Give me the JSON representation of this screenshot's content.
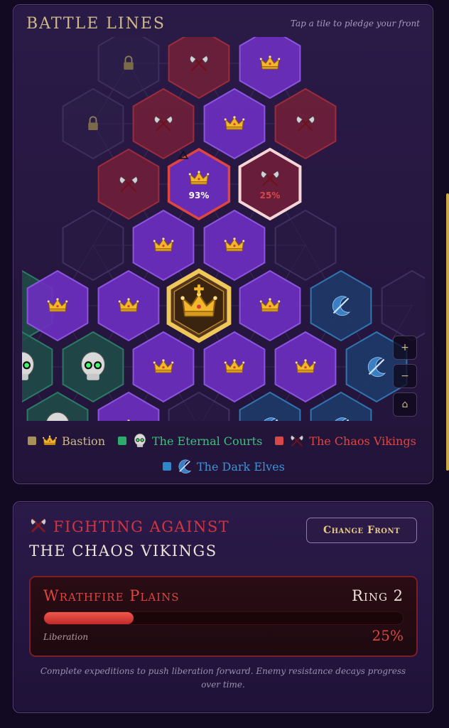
{
  "header": {
    "title": "BATTLE LINES",
    "hint": "Tap a tile to pledge your front"
  },
  "colors": {
    "bastion": "#a8905a",
    "eternal_courts": "#2dab6b",
    "chaos_vikings": "#d94848",
    "dark_elves": "#2f86c9",
    "bastion_tile": "#6c2fbf",
    "chaos_tile": "#6e1f3a",
    "eternal_tile": "#1f4a48",
    "elves_tile": "#1e3a68",
    "locked_tile": "#2c2149",
    "capital": "#f0c85a"
  },
  "board": {
    "tiles": [
      {
        "faction": "locked",
        "icon": "lock-icon"
      },
      {
        "faction": "chaos",
        "icon": "crossed-axes-icon"
      },
      {
        "faction": "bastion",
        "icon": "crown-icon"
      },
      {
        "faction": "locked",
        "icon": "lock-icon"
      },
      {
        "faction": "chaos",
        "icon": "crossed-axes-icon"
      },
      {
        "faction": "bastion",
        "icon": "crown-icon"
      },
      {
        "faction": "chaos",
        "icon": "crossed-axes-icon"
      },
      {
        "faction": "chaos",
        "icon": "crossed-axes-icon"
      },
      {
        "faction": "bastion",
        "icon": "crown-icon",
        "state": "contested",
        "progress": "93%",
        "warning": true
      },
      {
        "faction": "chaos",
        "icon": "crossed-axes-icon",
        "state": "selected",
        "progress": "25%"
      },
      {
        "faction": "empty"
      },
      {
        "faction": "bastion",
        "icon": "crown-icon"
      },
      {
        "faction": "bastion",
        "icon": "crown-icon"
      },
      {
        "faction": "empty"
      },
      {
        "faction": "eternal"
      },
      {
        "faction": "bastion",
        "icon": "crown-icon"
      },
      {
        "faction": "bastion",
        "icon": "crown-icon"
      },
      {
        "faction": "capital",
        "icon": "grand-crown-icon"
      },
      {
        "faction": "bastion",
        "icon": "crown-icon"
      },
      {
        "faction": "elves",
        "icon": "moon-blade-icon"
      },
      {
        "faction": "empty"
      },
      {
        "faction": "eternal",
        "icon": "skull-icon"
      },
      {
        "faction": "eternal",
        "icon": "skull-icon"
      },
      {
        "faction": "bastion",
        "icon": "crown-icon"
      },
      {
        "faction": "bastion",
        "icon": "crown-icon"
      },
      {
        "faction": "bastion",
        "icon": "crown-icon"
      },
      {
        "faction": "elves",
        "icon": "moon-blade-icon"
      },
      {
        "faction": "eternal",
        "icon": "skull-icon"
      },
      {
        "faction": "bastion",
        "icon": "crown-icon"
      },
      {
        "faction": "empty"
      },
      {
        "faction": "elves",
        "icon": "moon-blade-icon"
      },
      {
        "faction": "elves",
        "icon": "moon-blade-icon"
      }
    ],
    "controls": {
      "zoom_in": "+",
      "zoom_out": "−",
      "home": "⌂"
    }
  },
  "legend": [
    {
      "label": "Bastion",
      "color": "#a8905a",
      "text_color": "#cdb98a",
      "icon": "crown-icon"
    },
    {
      "label": "The Eternal Courts",
      "color": "#2dab6b",
      "text_color": "#3ec07c",
      "icon": "skull-icon"
    },
    {
      "label": "The Chaos Vikings",
      "color": "#d94848",
      "text_color": "#e0453f",
      "icon": "crossed-axes-icon"
    },
    {
      "label": "The Dark Elves",
      "color": "#2f86c9",
      "text_color": "#3d93d6",
      "icon": "moon-blade-icon"
    }
  ],
  "front": {
    "fighting_label": "FIGHTING AGAINST",
    "enemy": "THE CHAOS VIKINGS",
    "change_button": "Change Front",
    "zone": "Wrathfire Plains",
    "ring": "Ring 2",
    "liberation_label": "Liberation",
    "liberation_value": 0.25,
    "liberation_pct": "25%",
    "note": "Complete expeditions to push liberation forward. Enemy resistance decays progress over time."
  }
}
